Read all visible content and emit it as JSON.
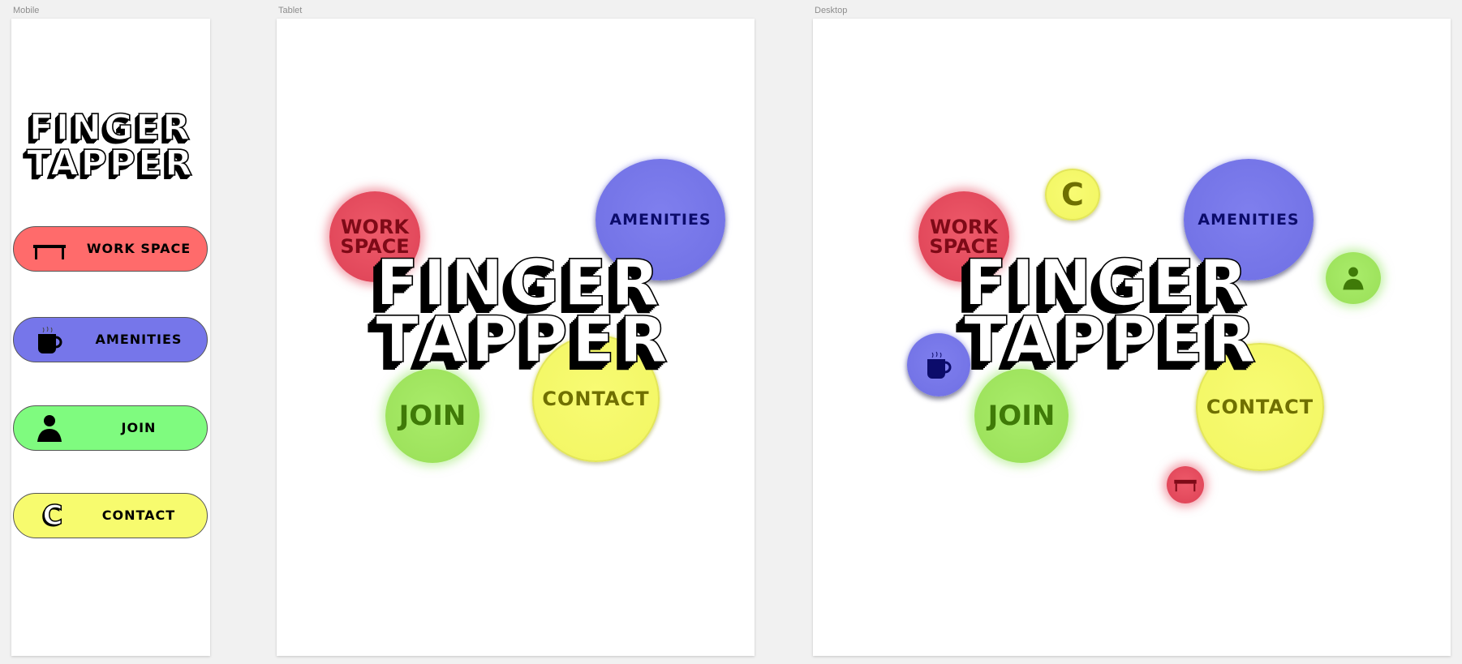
{
  "artboards": {
    "mobile": "Mobile",
    "tablet": "Tablet",
    "desktop": "Desktop"
  },
  "logo": {
    "line1": "FINGER",
    "line2": "TAPPER"
  },
  "nav": {
    "workspace": "WORK SPACE",
    "workspace_l1": "WORK",
    "workspace_l2": "SPACE",
    "amenities": "AMENITIES",
    "join": "JOIN",
    "contact": "CONTACT",
    "contact_icon_letter": "C"
  },
  "colors": {
    "workspace": "#ff6b6b",
    "amenities": "#7676ea",
    "join": "#7ffb7f",
    "contact": "#f7fb6e"
  },
  "icons": {
    "workspace": "table-icon",
    "amenities": "mug-icon",
    "join": "person-icon",
    "contact": "c-letter-icon"
  }
}
